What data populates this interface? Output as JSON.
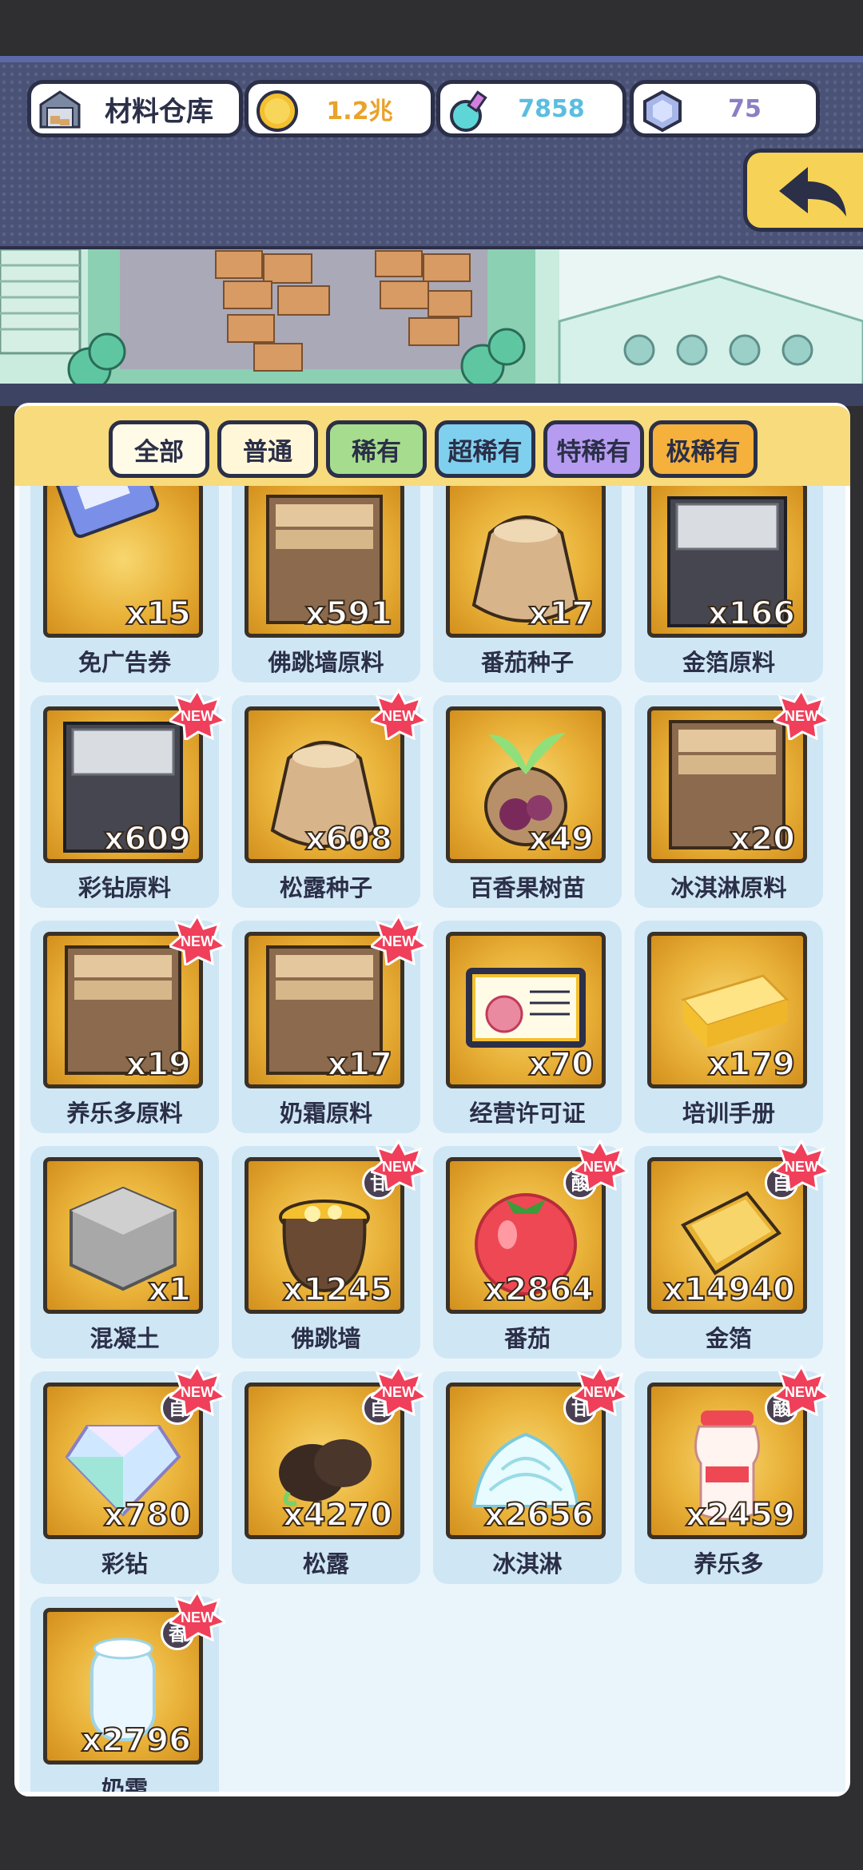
{
  "header": {
    "warehouse_label": "材料仓库",
    "coins": "1.2兆",
    "potion": "7858",
    "gems": "75",
    "colors": {
      "coin_text": "#e9a22b",
      "potion_text": "#5bbde0",
      "gem_text": "#8a7fc4"
    }
  },
  "filters": [
    {
      "label": "全部",
      "color": "#fffbe6"
    },
    {
      "label": "普通",
      "color": "#fff7d8"
    },
    {
      "label": "稀有",
      "color": "#a6dc8d"
    },
    {
      "label": "超稀有",
      "color": "#7fd0ef"
    },
    {
      "label": "特稀有",
      "color": "#b59cf0"
    },
    {
      "label": "极稀有",
      "color": "#f5b13b"
    }
  ],
  "items": [
    {
      "name": "免广告券",
      "qty": "x15",
      "icon": "ticket-icon",
      "new": false,
      "taste": ""
    },
    {
      "name": "佛跳墙原料",
      "qty": "x591",
      "icon": "box-icon",
      "new": false,
      "taste": ""
    },
    {
      "name": "番茄种子",
      "qty": "x17",
      "icon": "seed-bag-icon",
      "new": false,
      "taste": ""
    },
    {
      "name": "金箔原料",
      "qty": "x166",
      "icon": "metal-box-icon",
      "new": false,
      "taste": ""
    },
    {
      "name": "彩钻原料",
      "qty": "x609",
      "icon": "metal-box-icon",
      "new": true,
      "taste": ""
    },
    {
      "name": "松露种子",
      "qty": "x608",
      "icon": "seed-bag-icon",
      "new": true,
      "taste": ""
    },
    {
      "name": "百香果树苗",
      "qty": "x49",
      "icon": "sapling-icon",
      "new": false,
      "taste": ""
    },
    {
      "name": "冰淇淋原料",
      "qty": "x20",
      "icon": "box-icon",
      "new": true,
      "taste": ""
    },
    {
      "name": "养乐多原料",
      "qty": "x19",
      "icon": "box-icon",
      "new": true,
      "taste": ""
    },
    {
      "name": "奶霜原料",
      "qty": "x17",
      "icon": "box-icon",
      "new": true,
      "taste": ""
    },
    {
      "name": "经营许可证",
      "qty": "x70",
      "icon": "license-icon",
      "new": false,
      "taste": ""
    },
    {
      "name": "培训手册",
      "qty": "x179",
      "icon": "manual-icon",
      "new": false,
      "taste": ""
    },
    {
      "name": "混凝土",
      "qty": "x1",
      "icon": "concrete-icon",
      "new": false,
      "taste": ""
    },
    {
      "name": "佛跳墙",
      "qty": "x1245",
      "icon": "pot-icon",
      "new": true,
      "taste": "甘"
    },
    {
      "name": "番茄",
      "qty": "x2864",
      "icon": "tomato-icon",
      "new": true,
      "taste": "酸"
    },
    {
      "name": "金箔",
      "qty": "x14940",
      "icon": "gold-leaf-icon",
      "new": true,
      "taste": "自"
    },
    {
      "name": "彩钻",
      "qty": "x780",
      "icon": "diamond-icon",
      "new": true,
      "taste": "自"
    },
    {
      "name": "松露",
      "qty": "x4270",
      "icon": "truffle-icon",
      "new": true,
      "taste": "自"
    },
    {
      "name": "冰淇淋",
      "qty": "x2656",
      "icon": "cream-icon",
      "new": true,
      "taste": "甘"
    },
    {
      "name": "养乐多",
      "qty": "x2459",
      "icon": "yogurt-icon",
      "new": true,
      "taste": "酸"
    },
    {
      "name": "奶霜",
      "qty": "x2796",
      "icon": "milk-icon",
      "new": true,
      "taste": "香"
    }
  ],
  "new_badge_text": "NEW"
}
